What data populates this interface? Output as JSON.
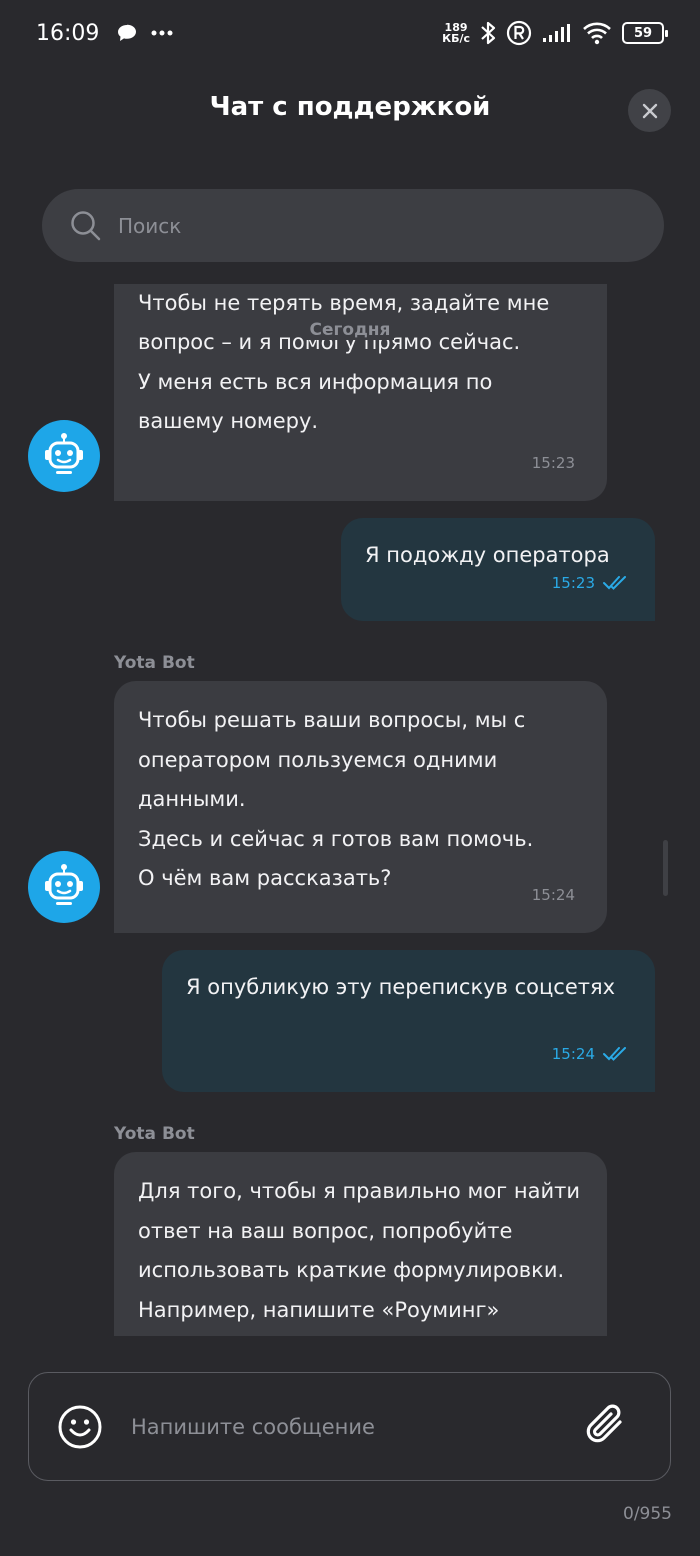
{
  "status_bar": {
    "time": "16:09",
    "speed_value": "189",
    "speed_unit": "КБ/с",
    "battery": "59"
  },
  "header": {
    "title": "Чат с поддержкой"
  },
  "search": {
    "placeholder": "Поиск"
  },
  "chat": {
    "date_divider": "Сегодня",
    "bot_name": "Yota Bot",
    "messages": [
      {
        "from": "bot",
        "text": "Оператора придется подождать.\nЧтобы не терять время, задайте мне вопрос – и я помогу прямо сейчас.\nУ меня есть вся информация по вашему номеру.",
        "time": "15:23"
      },
      {
        "from": "user",
        "text": "Я подожду оператора",
        "time": "15:23"
      },
      {
        "from": "bot",
        "text": "Чтобы решать ваши вопросы, мы с оператором пользуемся одними данными.\nЗдесь и сейчас я готов вам помочь.\nО чём вам рассказать?",
        "time": "15:24"
      },
      {
        "from": "user",
        "text": "Я опубликую эту перепискув соцсетях",
        "time": "15:24"
      },
      {
        "from": "bot",
        "text": "Для того, чтобы я правильно мог найти ответ на ваш вопрос, попробуйте использовать краткие формулировки.\nНапример, напишите «Роуминг»",
        "time": ""
      }
    ]
  },
  "composer": {
    "placeholder": "Напишите сообщение",
    "counter": "0/955"
  },
  "colors": {
    "background": "#29292d",
    "bot_bubble": "#3b3c41",
    "user_bubble": "#233640",
    "accent": "#1ea6e8",
    "read_ticks": "#2aaae6"
  },
  "icons": {
    "search": "search-icon",
    "close": "close-icon",
    "bot_avatar": "robot-icon",
    "read_receipt": "double-check-icon",
    "emoji": "smiley-icon",
    "attach": "paperclip-icon"
  }
}
